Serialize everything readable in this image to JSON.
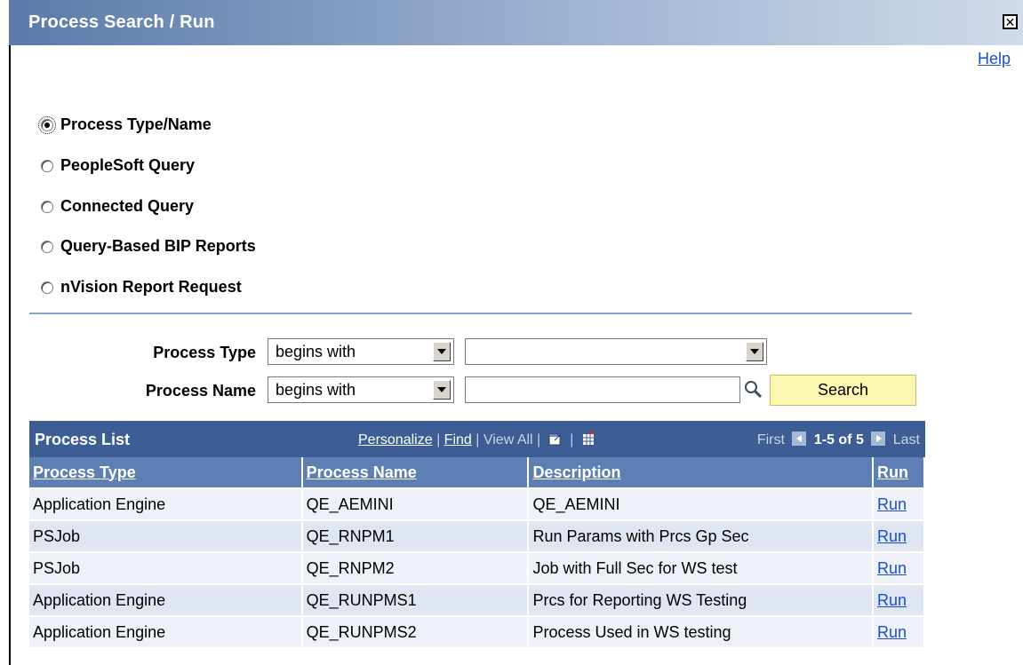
{
  "window": {
    "title": "Process Search / Run",
    "close_symbol": "✕"
  },
  "help_label": "Help",
  "radio_options": [
    {
      "label": "Process Type/Name",
      "checked": true
    },
    {
      "label": "PeopleSoft Query",
      "checked": false
    },
    {
      "label": "Connected Query",
      "checked": false
    },
    {
      "label": "Query-Based BIP Reports",
      "checked": false
    },
    {
      "label": "nVision Report Request",
      "checked": false
    }
  ],
  "criteria": {
    "process_type_label": "Process Type",
    "process_type_operator": "begins with",
    "process_type_value": "",
    "process_name_label": "Process Name",
    "process_name_operator": "begins with",
    "process_name_value": "",
    "search_label": "Search"
  },
  "grid": {
    "title": "Process List",
    "personalize": "Personalize",
    "find": "Find",
    "view_all": "View All",
    "first": "First",
    "range": "1-5 of 5",
    "last": "Last",
    "columns": [
      "Process Type",
      "Process Name",
      "Description",
      "Run"
    ],
    "rows": [
      {
        "type": "Application Engine",
        "name": "QE_AEMINI",
        "description": "QE_AEMINI",
        "run": "Run"
      },
      {
        "type": "PSJob",
        "name": "QE_RNPM1",
        "description": "Run Params with Prcs Gp Sec",
        "run": "Run"
      },
      {
        "type": "PSJob",
        "name": "QE_RNPM2",
        "description": "Job with Full Sec for WS test",
        "run": "Run"
      },
      {
        "type": "Application Engine",
        "name": "QE_RUNPMS1",
        "description": "Prcs for Reporting WS Testing",
        "run": "Run"
      },
      {
        "type": "Application Engine",
        "name": "QE_RUNPMS2",
        "description": "Process Used in WS testing",
        "run": "Run"
      }
    ]
  },
  "colors": {
    "header_bg": "#3c5e94",
    "column_header_bg": "#5d7fb3",
    "search_button": "#fbf6b0",
    "link": "#1a4fc6"
  }
}
